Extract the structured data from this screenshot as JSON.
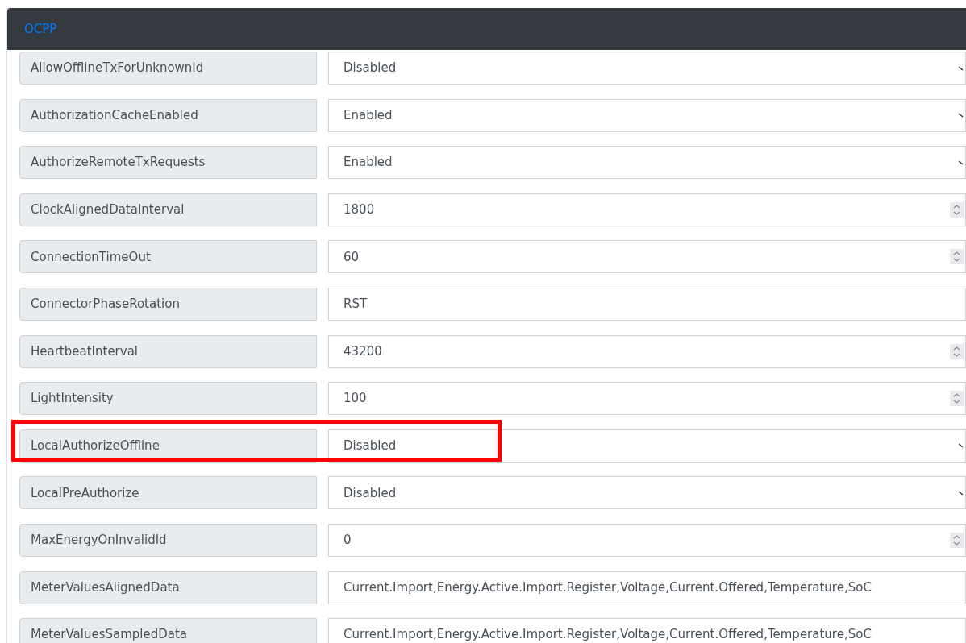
{
  "header": {
    "title": "OCPP"
  },
  "settings": [
    {
      "label": "AllowOfflineTxForUnknownId",
      "value": "Disabled",
      "kind": "select",
      "highlighted": false
    },
    {
      "label": "AuthorizationCacheEnabled",
      "value": "Enabled",
      "kind": "select",
      "highlighted": false
    },
    {
      "label": "AuthorizeRemoteTxRequests",
      "value": "Enabled",
      "kind": "select",
      "highlighted": false
    },
    {
      "label": "ClockAlignedDataInterval",
      "value": "1800",
      "kind": "number",
      "highlighted": false
    },
    {
      "label": "ConnectionTimeOut",
      "value": "60",
      "kind": "number",
      "highlighted": false
    },
    {
      "label": "ConnectorPhaseRotation",
      "value": "RST",
      "kind": "text",
      "highlighted": false
    },
    {
      "label": "HeartbeatInterval",
      "value": "43200",
      "kind": "number",
      "highlighted": false
    },
    {
      "label": "LightIntensity",
      "value": "100",
      "kind": "number",
      "highlighted": false
    },
    {
      "label": "LocalAuthorizeOffline",
      "value": "Disabled",
      "kind": "select",
      "highlighted": true
    },
    {
      "label": "LocalPreAuthorize",
      "value": "Disabled",
      "kind": "select",
      "highlighted": false
    },
    {
      "label": "MaxEnergyOnInvalidId",
      "value": "0",
      "kind": "number",
      "highlighted": false
    },
    {
      "label": "MeterValuesAlignedData",
      "value": "Current.Import,Energy.Active.Import.Register,Voltage,Current.Offered,Temperature,SoC",
      "kind": "text",
      "highlighted": false
    },
    {
      "label": "MeterValuesSampledData",
      "value": "Current.Import,Energy.Active.Import.Register,Voltage,Current.Offered,Temperature,SoC",
      "kind": "text",
      "highlighted": false
    }
  ]
}
